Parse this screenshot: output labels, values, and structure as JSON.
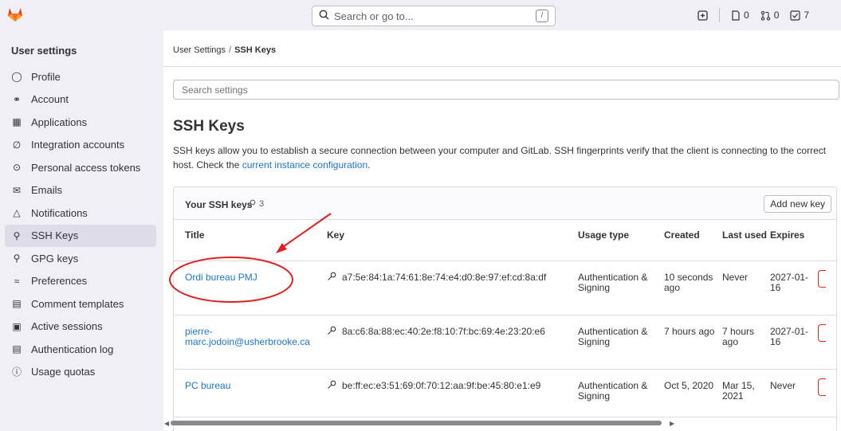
{
  "topbar": {
    "search_placeholder": "Search or go to...",
    "search_shortcut": "/",
    "issues_count": "0",
    "merge_requests_count": "0",
    "todos_count": "7"
  },
  "sidebar": {
    "title": "User settings",
    "items": [
      {
        "label": "Profile",
        "icon": "profile-icon"
      },
      {
        "label": "Account",
        "icon": "account-icon"
      },
      {
        "label": "Applications",
        "icon": "applications-icon"
      },
      {
        "label": "Integration accounts",
        "icon": "integration-icon"
      },
      {
        "label": "Personal access tokens",
        "icon": "token-icon"
      },
      {
        "label": "Emails",
        "icon": "mail-icon"
      },
      {
        "label": "Notifications",
        "icon": "bell-icon"
      },
      {
        "label": "SSH Keys",
        "icon": "key-icon",
        "active": true
      },
      {
        "label": "GPG keys",
        "icon": "key-icon"
      },
      {
        "label": "Preferences",
        "icon": "preferences-icon"
      },
      {
        "label": "Comment templates",
        "icon": "comment-icon"
      },
      {
        "label": "Active sessions",
        "icon": "monitor-icon"
      },
      {
        "label": "Authentication log",
        "icon": "log-icon"
      },
      {
        "label": "Usage quotas",
        "icon": "quota-icon"
      }
    ]
  },
  "breadcrumb": {
    "parent": "User Settings",
    "sep": "/",
    "current": "SSH Keys"
  },
  "search_settings_placeholder": "Search settings",
  "page": {
    "title": "SSH Keys",
    "desc_pre": "SSH keys allow you to establish a secure connection between your computer and GitLab. SSH fingerprints verify that the client is connecting to the correct host. Check the ",
    "desc_link": "current instance configuration",
    "desc_post": "."
  },
  "card": {
    "title": "Your SSH keys",
    "count": "3",
    "add_button": "Add new key"
  },
  "table": {
    "headers": {
      "title": "Title",
      "key": "Key",
      "usage": "Usage type",
      "created": "Created",
      "last_used": "Last used",
      "expires": "Expires"
    },
    "rows": [
      {
        "title": "Ordi bureau PMJ",
        "key": "a7:5e:84:1a:74:61:8e:74:e4:d0:8e:97:ef:cd:8a:df",
        "usage": "Authentication & Signing",
        "created": "10 seconds ago",
        "last_used": "Never",
        "expires": "2027-01-16"
      },
      {
        "title": "pierre-marc.jodoin@usherbrooke.ca",
        "key": "8a:c6:8a:88:ec:40:2e:f8:10:7f:bc:69:4e:23:20:e6",
        "usage": "Authentication & Signing",
        "created": "7 hours ago",
        "last_used": "7 hours ago",
        "expires": "2027-01-16"
      },
      {
        "title": "PC bureau",
        "key": "be:ff:ec:e3:51:69:0f:70:12:aa:9f:be:45:80:e1:e9",
        "usage": "Authentication & Signing",
        "created": "Oct 5, 2020",
        "last_used": "Mar 15, 2021",
        "expires": "Never"
      }
    ]
  },
  "colors": {
    "link": "#1f75cb",
    "annotation": "#e02020",
    "danger": "#dd2b0e"
  }
}
